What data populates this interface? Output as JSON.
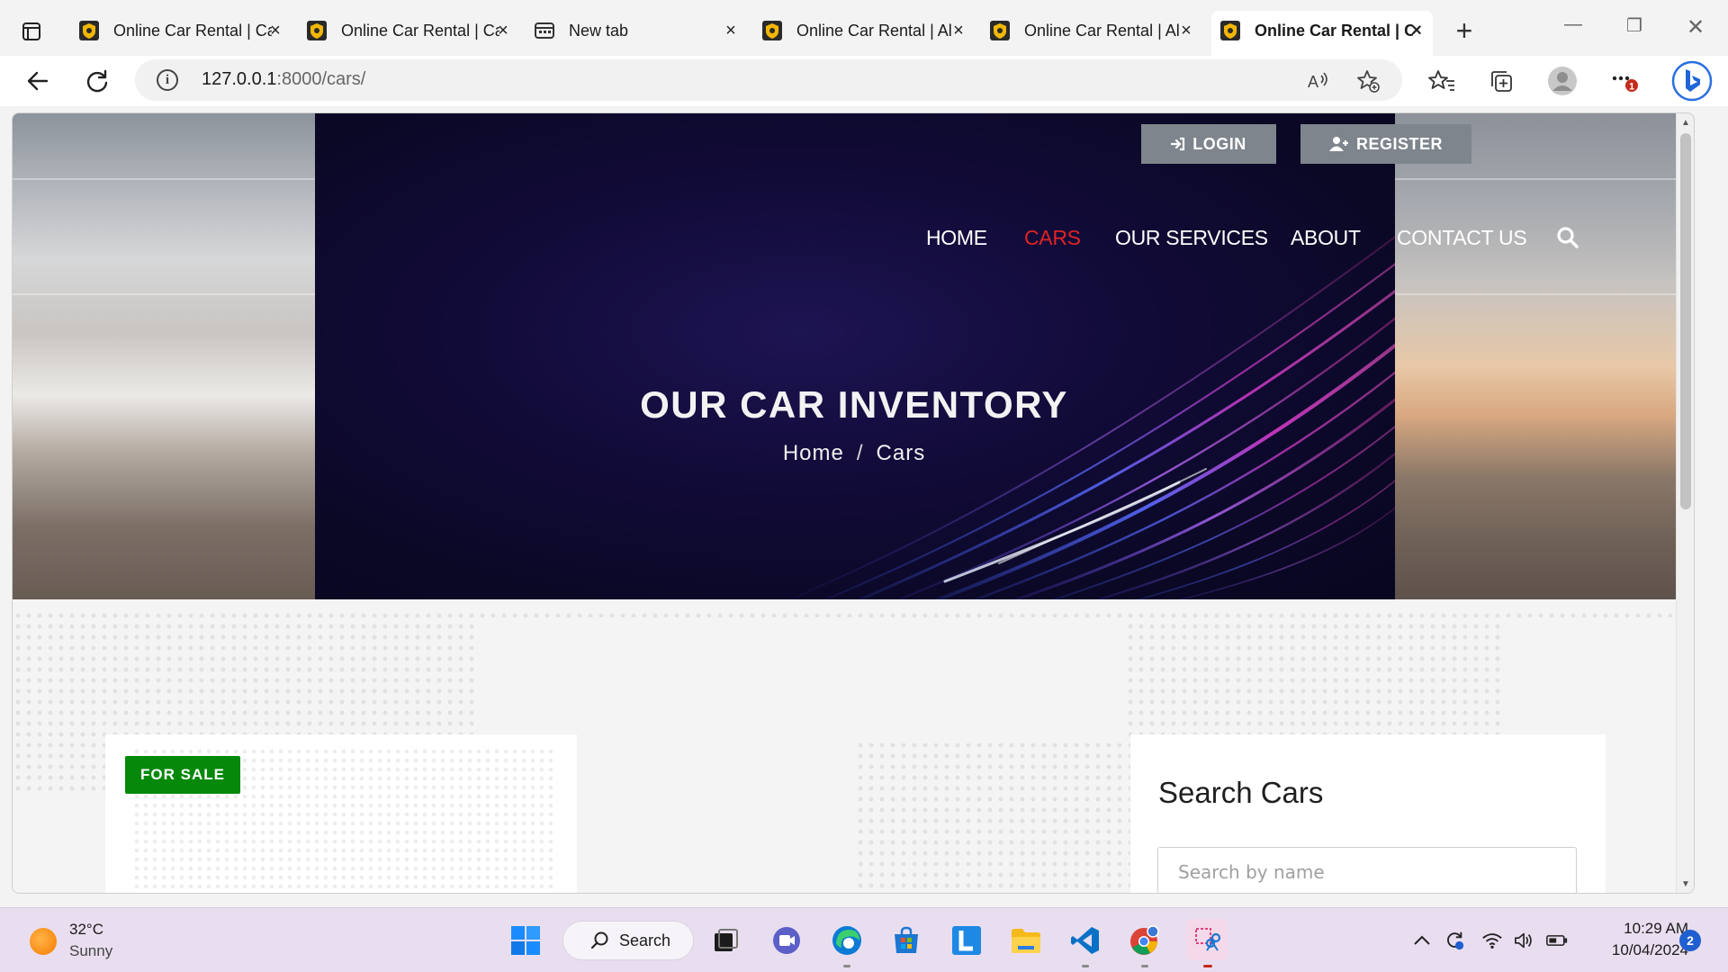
{
  "browser": {
    "tabs": [
      {
        "title": "Online Car Rental | Ca",
        "active": false
      },
      {
        "title": "Online Car Rental | Ca",
        "active": false
      },
      {
        "title": "New tab",
        "active": false
      },
      {
        "title": "Online Car Rental | Al",
        "active": false
      },
      {
        "title": "Online Car Rental | Al",
        "active": false
      },
      {
        "title": "Online Car Rental | C",
        "active": true
      }
    ],
    "url_host": "127.0.0.1",
    "url_path": ":8000/cars/",
    "profile_alert": "1"
  },
  "page": {
    "top_buttons": {
      "login": "LOGIN",
      "register": "REGISTER"
    },
    "nav": [
      "HOME",
      "CARS",
      "OUR SERVICES",
      "ABOUT",
      "CONTACT US"
    ],
    "active_nav": "CARS",
    "hero_title": "OUR CAR INVENTORY",
    "breadcrumb": {
      "home": "Home",
      "separator": "/",
      "current": "Cars"
    },
    "listing_badge": "FOR SALE",
    "search": {
      "heading": "Search Cars",
      "placeholder": "Search by name"
    }
  },
  "colors": {
    "active_nav": "#e02424",
    "badge": "#06880a",
    "top_button": "#7e858c",
    "hero_bg": "#0b0826"
  },
  "taskbar": {
    "weather_temp": "32°C",
    "weather_cond": "Sunny",
    "search_label": "Search",
    "time": "10:29 AM",
    "date": "10/04/2024",
    "notifications": "2"
  }
}
